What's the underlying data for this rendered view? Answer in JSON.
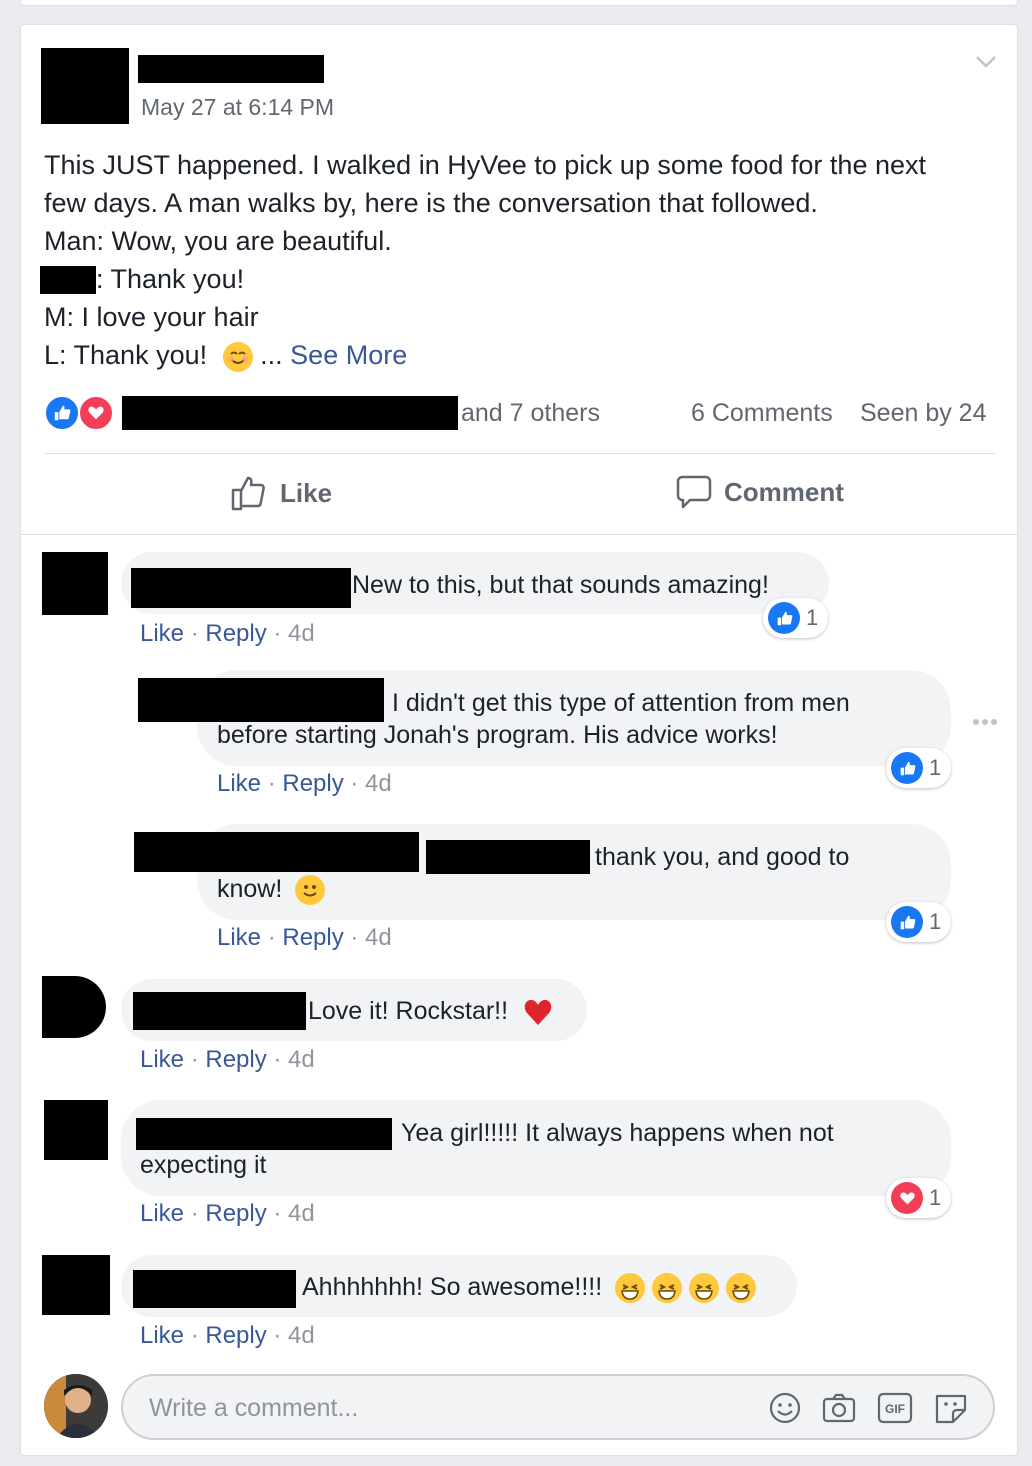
{
  "post": {
    "timestamp": "May 27 at 6:14 PM",
    "text_lines": [
      "This JUST happened. I walked in HyVee to pick up some food for the next",
      "few days. A man walks by, here is the conversation that followed.",
      "Man: Wow, you are beautiful.",
      ": Thank you!",
      "M: I love your hair",
      "L: Thank you!"
    ],
    "ellipsis": "...",
    "see_more": "See More",
    "reactions_others": "and 7 others",
    "comments_count": "6 Comments",
    "seen_by": "Seen by 24"
  },
  "actions": {
    "like": "Like",
    "comment": "Comment"
  },
  "comments": [
    {
      "text": "New to this, but that sounds amazing!",
      "like": "Like",
      "reply": "Reply",
      "time": "4d",
      "reaction": "like",
      "reaction_count": "1"
    },
    {
      "text_line1": "I didn't get this type of attention from men",
      "text_line2": "before starting Jonah's program. His advice works!",
      "like": "Like",
      "reply": "Reply",
      "time": "4d",
      "reaction": "like",
      "reaction_count": "1"
    },
    {
      "text_line1": "thank you, and good to",
      "text_line2": "know!",
      "like": "Like",
      "reply": "Reply",
      "time": "4d",
      "reaction": "like",
      "reaction_count": "1"
    },
    {
      "text": "Love it! Rockstar!!",
      "like": "Like",
      "reply": "Reply",
      "time": "4d"
    },
    {
      "text_line1": "Yea girl!!!!! It always happens when not",
      "text_line2": "expecting it",
      "like": "Like",
      "reply": "Reply",
      "time": "4d",
      "reaction": "love",
      "reaction_count": "1"
    },
    {
      "text": "Ahhhhhhh! So awesome!!!!",
      "like": "Like",
      "reply": "Reply",
      "time": "4d"
    }
  ],
  "composer": {
    "placeholder": "Write a comment...",
    "tools": [
      "emoji-icon",
      "camera-icon",
      "gif-icon",
      "sticker-icon"
    ]
  },
  "colors": {
    "link": "#385898",
    "like_blue": "#1877f2",
    "love_red": "#f33e58",
    "bubble": "#f2f3f5"
  }
}
